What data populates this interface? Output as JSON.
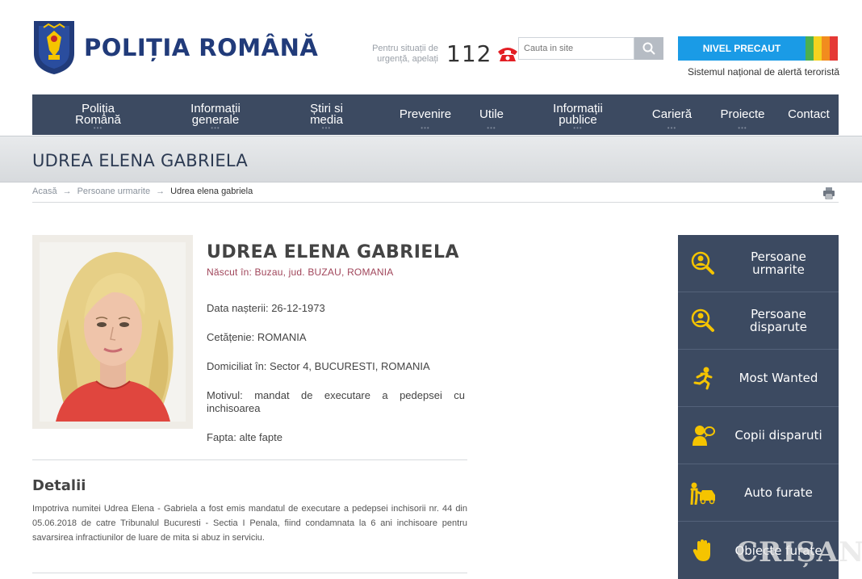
{
  "header": {
    "logo_text": "POLIȚIA ROMÂNĂ",
    "emergency_text_line1": "Pentru situații de",
    "emergency_text_line2": "urgență, apelați",
    "emergency_number": "112",
    "search_placeholder": "Cauta in site",
    "alert_label": "NIVEL PRECAUT",
    "alert_caption": "Sistemul național de alertă teroristă",
    "alert_colors": [
      "#4caf50",
      "#f4d21f",
      "#f28c1e",
      "#e53935"
    ]
  },
  "nav": [
    {
      "line1": "Poliția",
      "line2": "Română",
      "dots": "•••"
    },
    {
      "line1": "Informații",
      "line2": "generale",
      "dots": "•••"
    },
    {
      "line1": "Știri si",
      "line2": "media",
      "dots": "•••"
    },
    {
      "line1": "Prevenire",
      "line2": "",
      "dots": "•••"
    },
    {
      "line1": "Utile",
      "line2": "",
      "dots": "•••"
    },
    {
      "line1": "Informații",
      "line2": "publice",
      "dots": "•••"
    },
    {
      "line1": "Carieră",
      "line2": "",
      "dots": "•••"
    },
    {
      "line1": "Proiecte",
      "line2": "",
      "dots": "•••"
    },
    {
      "line1": "Contact",
      "line2": "",
      "dots": ""
    }
  ],
  "page": {
    "title": "UDREA ELENA GABRIELA"
  },
  "breadcrumb": {
    "home": "Acasă",
    "section": "Persoane urmarite",
    "current": "Udrea elena gabriela"
  },
  "profile": {
    "name": "UDREA ELENA GABRIELA",
    "born": "Născut în: Buzau, jud. BUZAU, ROMANIA",
    "birth_date": "Data nașterii: 26-12-1973",
    "citizenship": "Cetățenie: ROMANIA",
    "residence": "Domiciliat în: Sector 4, BUCURESTI, ROMANIA",
    "motive": "Motivul: mandat de executare a pedepsei cu inchisoarea",
    "deed": "Fapta: alte fapte"
  },
  "details": {
    "title": "Detalii",
    "text": "Impotriva numitei Udrea Elena - Gabriela a fost emis mandatul de executare a pedepsei inchisorii nr. 44 din 05.06.2018 de catre Tribunalul Bucuresti - Sectia I Penala, fiind condamnata la 6 ani inchisoare pentru savarsirea infractiunilor de luare de mita si abuz in serviciu."
  },
  "sidebar": [
    {
      "line1": "Persoane",
      "line2": "urmarite",
      "icon": "search-person-icon"
    },
    {
      "line1": "Persoane",
      "line2": "disparute",
      "icon": "search-person-icon"
    },
    {
      "line1": "Most Wanted",
      "line2": "",
      "icon": "running-person-icon"
    },
    {
      "line1": "Copii disparuti",
      "line2": "",
      "icon": "child-icon"
    },
    {
      "line1": "Auto furate",
      "line2": "",
      "icon": "car-thief-icon"
    },
    {
      "line1": "Obiecte furate",
      "line2": "",
      "icon": "hand-icon"
    }
  ],
  "watermark": "CRIȘANA",
  "colors": {
    "nav_bg": "#3c4a61",
    "accent_yellow": "#f5c400",
    "logo_blue": "#213b7a",
    "alert_blue": "#1a9be6"
  }
}
